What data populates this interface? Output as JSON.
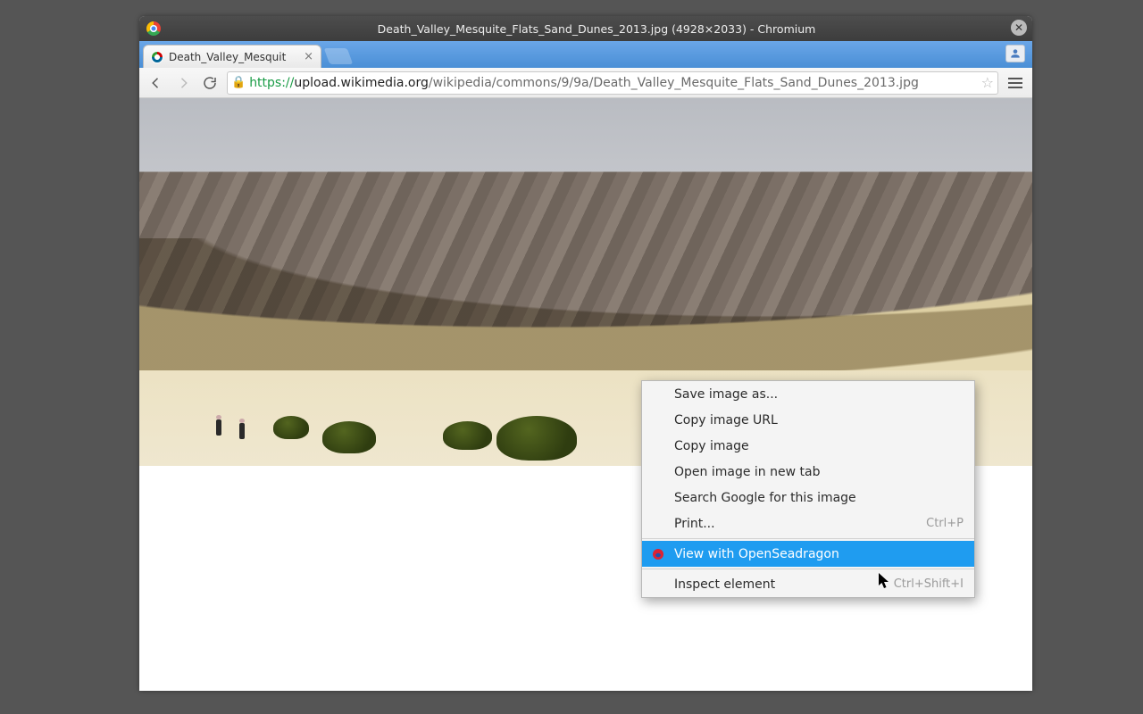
{
  "window": {
    "title": "Death_Valley_Mesquite_Flats_Sand_Dunes_2013.jpg (4928×2033) - Chromium"
  },
  "tab": {
    "title": "Death_Valley_Mesquit"
  },
  "url": {
    "protocol": "https://",
    "host": "upload.wikimedia.org",
    "path": "/wikipedia/commons/9/9a/Death_Valley_Mesquite_Flats_Sand_Dunes_2013.jpg"
  },
  "context_menu": {
    "items": [
      {
        "label": "Save image as...",
        "shortcut": ""
      },
      {
        "label": "Copy image URL",
        "shortcut": ""
      },
      {
        "label": "Copy image",
        "shortcut": ""
      },
      {
        "label": "Open image in new tab",
        "shortcut": ""
      },
      {
        "label": "Search Google for this image",
        "shortcut": ""
      },
      {
        "label": "Print...",
        "shortcut": "Ctrl+P"
      }
    ],
    "highlighted": {
      "label": "View with OpenSeadragon",
      "shortcut": ""
    },
    "inspect": {
      "label": "Inspect element",
      "shortcut": "Ctrl+Shift+I"
    }
  }
}
